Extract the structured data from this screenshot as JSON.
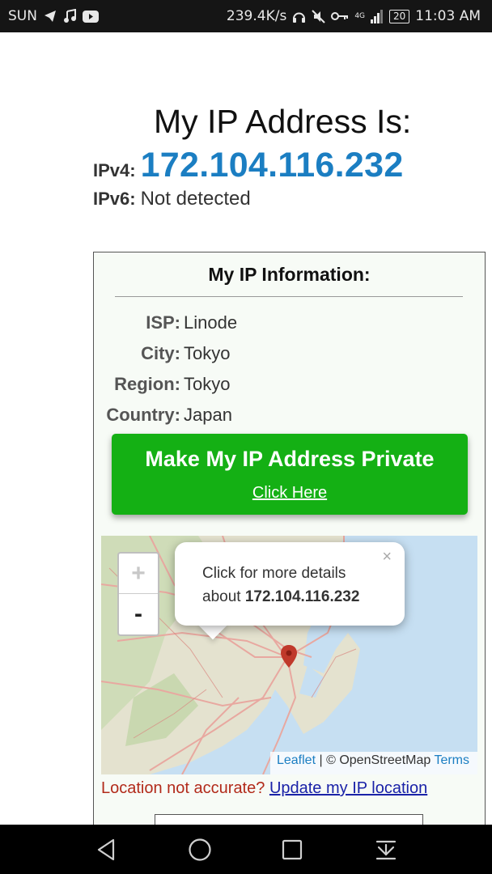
{
  "status_bar": {
    "carrier": "SUN",
    "net_speed": "239.4K/s",
    "network": "4G",
    "battery": "20",
    "time": "11:03 AM",
    "icons": [
      "telegram-icon",
      "music-icon",
      "youtube-icon",
      "headset-icon",
      "mute-icon",
      "key-icon",
      "signal-icon",
      "battery-icon"
    ]
  },
  "header": {
    "title": "My IP Address Is:",
    "ipv4_label": "IPv4:",
    "ipv4_value": "172.104.116.232",
    "ipv6_label": "IPv6:",
    "ipv6_value": "Not detected"
  },
  "info": {
    "title": "My IP Information:",
    "rows": [
      {
        "key": "ISP:",
        "value": "Linode"
      },
      {
        "key": "City:",
        "value": "Tokyo"
      },
      {
        "key": "Region:",
        "value": "Tokyo"
      },
      {
        "key": "Country:",
        "value": "Japan"
      }
    ]
  },
  "cta": {
    "title": "Make My IP Address Private",
    "link": "Click Here"
  },
  "map": {
    "zoom_in": "+",
    "zoom_out": "-",
    "popup_close": "×",
    "popup_line1": "Click for more details",
    "popup_line2_prefix": "about",
    "popup_ip": "172.104.116.232",
    "attr_leaflet": "Leaflet",
    "attr_sep": "| © OpenStreetMap",
    "attr_terms": "Terms"
  },
  "location": {
    "prompt": "Location not accurate?",
    "link": "Update my IP location"
  },
  "colors": {
    "ip_blue": "#1b7ec2",
    "cta_green": "#14b014",
    "warn_red": "#b22a1a",
    "link_blue": "#1a22a8"
  }
}
